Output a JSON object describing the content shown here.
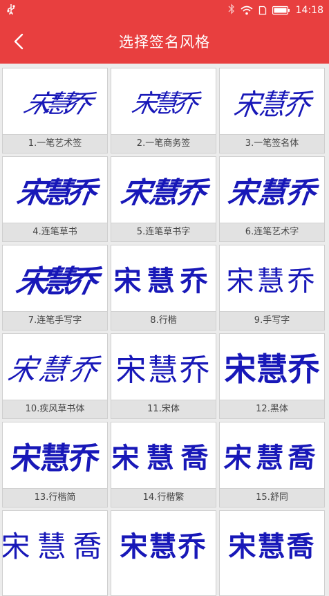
{
  "status_bar": {
    "usb_icon": "usb-icon",
    "time": "14:18",
    "icons": [
      "bluetooth-icon",
      "wifi-icon",
      "sim-icon",
      "battery-icon"
    ]
  },
  "header": {
    "title": "选择签名风格",
    "back_icon": "chevron-left-icon",
    "background": "#e83f3f"
  },
  "signature_text": "宋慧乔",
  "signature_color": "#1818b8",
  "styles": [
    {
      "sample": "宋慧乔",
      "label": "1.一笔艺术签"
    },
    {
      "sample": "宋慧乔",
      "label": "2.一笔商务签"
    },
    {
      "sample": "宋慧乔",
      "label": "3.一笔签名体"
    },
    {
      "sample": "宋慧乔",
      "label": "4.连笔草书"
    },
    {
      "sample": "宋慧乔",
      "label": "5.连笔草书字"
    },
    {
      "sample": "宋慧乔",
      "label": "6.连笔艺术字"
    },
    {
      "sample": "宋慧乔",
      "label": "7.连笔手写字"
    },
    {
      "sample": "宋慧乔",
      "label": "8.行楷"
    },
    {
      "sample": "宋慧乔",
      "label": "9.手写字"
    },
    {
      "sample": "宋慧乔",
      "label": "10.疾风草书体"
    },
    {
      "sample": "宋慧乔",
      "label": "11.宋体"
    },
    {
      "sample": "宋慧乔",
      "label": "12.黑体"
    },
    {
      "sample": "宋慧乔",
      "label": "13.行楷简"
    },
    {
      "sample": "宋慧喬",
      "label": "14.行楷繁"
    },
    {
      "sample": "宋慧喬",
      "label": "15.舒同"
    },
    {
      "sample": "宋慧喬",
      "label": ""
    },
    {
      "sample": "宋慧乔",
      "label": ""
    },
    {
      "sample": "宋慧喬",
      "label": ""
    }
  ]
}
